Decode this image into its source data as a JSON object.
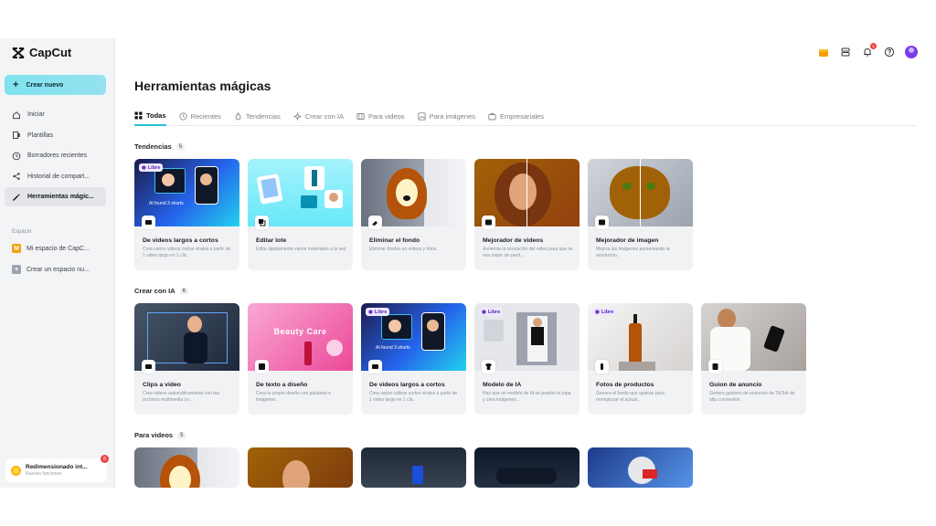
{
  "app": {
    "logo_text": "CapCut"
  },
  "sidebar": {
    "create_label": "Crear nuevo",
    "items": [
      {
        "label": "Iniciar",
        "icon": "home-icon"
      },
      {
        "label": "Plantillas",
        "icon": "templates-icon"
      },
      {
        "label": "Borradores recientes",
        "icon": "clock-icon"
      },
      {
        "label": "Historial de compart...",
        "icon": "share-icon"
      },
      {
        "label": "Herramientas mágic...",
        "icon": "magic-wand-icon",
        "active": true
      }
    ],
    "section_label": "Espacio",
    "spaces": [
      {
        "label": "Mi espacio de CapC...",
        "initial": "M",
        "color": "#f59e0b"
      },
      {
        "label": "Crear un espacio nu...",
        "initial": "+",
        "color": "#9ca3af"
      }
    ],
    "promo": {
      "title": "Redimensionado int...",
      "subtitle": "Nuevas funciones",
      "badge": "8"
    }
  },
  "topbar": {
    "notification_count": "1"
  },
  "main": {
    "title": "Herramientas mágicas",
    "tabs": [
      {
        "label": "Todas",
        "icon": "grid-icon",
        "active": true
      },
      {
        "label": "Recientes",
        "icon": "clock-icon"
      },
      {
        "label": "Tendencias",
        "icon": "flame-icon"
      },
      {
        "label": "Crear con IA",
        "icon": "sparkle-icon"
      },
      {
        "label": "Para videos",
        "icon": "film-icon"
      },
      {
        "label": "Para imágenes",
        "icon": "image-icon"
      },
      {
        "label": "Empresariales",
        "icon": "briefcase-icon"
      }
    ],
    "sections": [
      {
        "title": "Tendencias",
        "count": "5",
        "cards": [
          {
            "title": "De videos largos a cortos",
            "desc": "Crea varios videos cortos virales a partir de 1 video largo en 1 clic.",
            "free": "Libre"
          },
          {
            "title": "Editar lote",
            "desc": "Edita rápidamente varios materiales a la vez."
          },
          {
            "title": "Eliminar el fondo",
            "desc": "Eliminar fondos en videos y fotos."
          },
          {
            "title": "Mejorador de videos",
            "desc": "Aumenta la resolución del video para que se vea mejor sin perd..."
          },
          {
            "title": "Mejorador de imagen",
            "desc": "Mejora las imágenes aumentando la resolución."
          }
        ]
      },
      {
        "title": "Crear con IA",
        "count": "6",
        "cards": [
          {
            "title": "Clips a video",
            "desc": "Crea videos automáticamente con tus archivos multimedia co..."
          },
          {
            "title": "De texto a diseño",
            "desc": "Crea tu propio diseño con palabras e imágenes.",
            "overlay": "Beauty Care"
          },
          {
            "title": "De videos largos a cortos",
            "desc": "Crea varios videos cortos virales a partir de 1 video largo en 1 clic.",
            "free": "Libre"
          },
          {
            "title": "Modelo de IA",
            "desc": "Haz que un modelo de IA se pruebe la ropa y crea imágenes...",
            "free": "Libre"
          },
          {
            "title": "Fotos de productos",
            "desc": "Genera el fondo que quieras para reemplazar el actual...",
            "free": "Libre"
          },
          {
            "title": "Guion de anuncio",
            "desc": "Genera guiones de anuncios de TikTok de alta conversión."
          }
        ]
      },
      {
        "title": "Para videos",
        "count": "5"
      }
    ],
    "thumb_caption": "AI found 3 shorts"
  }
}
